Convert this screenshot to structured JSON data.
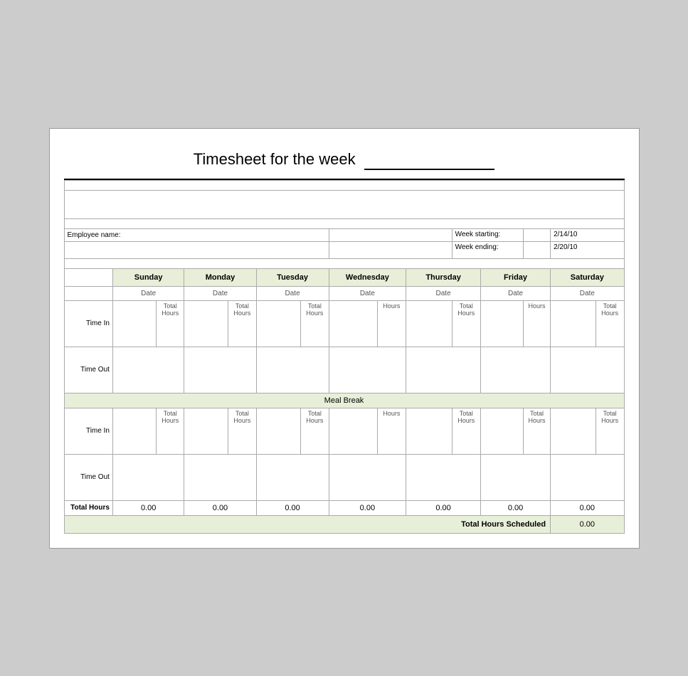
{
  "title": {
    "text": "Timesheet for the week",
    "underline_placeholder": "_________________"
  },
  "info": {
    "employee_name_label": "Employee name:",
    "employee_name_value": "",
    "week_starting_label": "Week starting:",
    "week_starting_value": "2/14/10",
    "week_ending_label": "Week ending:",
    "week_ending_value": "2/20/10"
  },
  "days": [
    {
      "label": "Sunday",
      "date_label": "Date"
    },
    {
      "label": "Monday",
      "date_label": "Date"
    },
    {
      "label": "Tuesday",
      "date_label": "Date"
    },
    {
      "label": "Wednesday",
      "date_label": "Date"
    },
    {
      "label": "Thursday",
      "date_label": "Date"
    },
    {
      "label": "Friday",
      "date_label": "Date"
    },
    {
      "label": "Saturday",
      "date_label": "Date"
    }
  ],
  "labels": {
    "time_in": "Time In",
    "time_out": "Time Out",
    "total_hours": "Total Hours",
    "hours": "Hours",
    "meal_break": "Meal Break",
    "total_hours_row": "Total Hours",
    "total_hours_scheduled": "Total Hours Scheduled"
  },
  "values": {
    "sunday": "0.00",
    "monday": "0.00",
    "tuesday": "0.00",
    "wednesday": "0.00",
    "thursday": "0.00",
    "friday": "0.00",
    "saturday": "0.00",
    "total_scheduled": "0.00"
  }
}
